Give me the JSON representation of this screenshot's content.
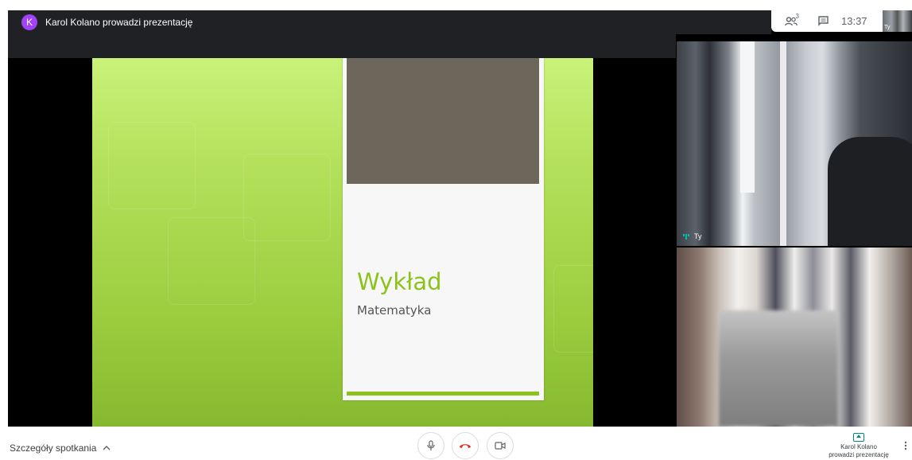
{
  "topbar": {
    "avatar_letter": "K",
    "presenting_text": "Karol Kolano prowadzi prezentację"
  },
  "top_right": {
    "people_count": "3",
    "people_icon": "people-icon",
    "chat_icon": "chat-icon",
    "time": "13:37",
    "self_label": "Ty"
  },
  "slide": {
    "title": "Wykład",
    "subtitle": "Matematyka"
  },
  "tiles": {
    "self_name": "Ty"
  },
  "bottom": {
    "details_label": "Szczegóły spotkania",
    "mic_icon": "microphone-icon",
    "hangup_icon": "hangup-icon",
    "camera_icon": "camera-icon",
    "present_label_line1": "Karol Kolano",
    "present_label_line2": "prowadzi prezentację",
    "more_icon": "more-vert-icon"
  },
  "colors": {
    "accent_green": "#8cc21c",
    "avatar_purple": "#a142f4",
    "hangup_red": "#d93025",
    "present_teal": "#00897b"
  }
}
